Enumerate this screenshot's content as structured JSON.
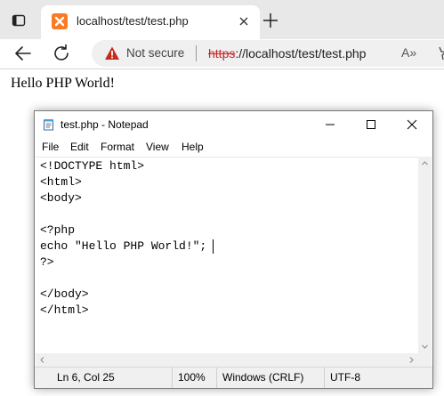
{
  "browser": {
    "tab": {
      "title": "localhost/test/test.php"
    },
    "security_label": "Not secure",
    "url": {
      "scheme": "https",
      "rest": "://localhost/test/test.php"
    },
    "read_aloud_label": "A»"
  },
  "page": {
    "text": "Hello PHP World!"
  },
  "notepad": {
    "title": "test.php - Notepad",
    "menu": [
      "File",
      "Edit",
      "Format",
      "View",
      "Help"
    ],
    "lines": [
      "<!DOCTYPE html>",
      "<html>",
      "<body>",
      "",
      "<?php",
      "echo \"Hello PHP World!\";",
      "?>",
      "",
      "</body>",
      "</html>"
    ],
    "status": {
      "position": "Ln 6, Col 25",
      "zoom": "100%",
      "line_ending": "Windows (CRLF)",
      "encoding": "UTF-8"
    }
  }
}
